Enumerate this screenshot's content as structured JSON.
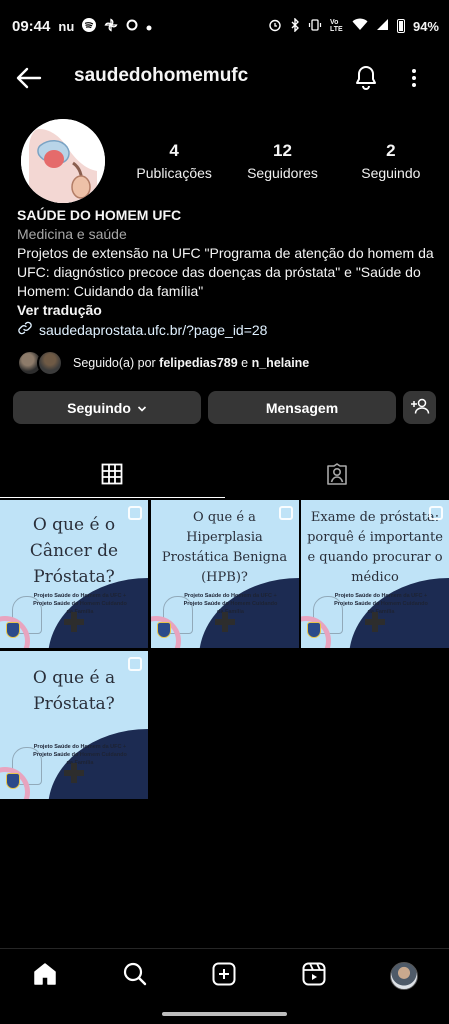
{
  "status_bar": {
    "time": "09:44",
    "left_icons": [
      "nu-icon",
      "spotify-icon",
      "pinwheel-icon",
      "circle-icon",
      "dot-icon"
    ],
    "nu_label": "nu",
    "battery": "94%",
    "network_label": "Vo LTE"
  },
  "header": {
    "username": "saudedohomemufc"
  },
  "profile": {
    "stats": [
      {
        "value": "4",
        "label": "Publicações"
      },
      {
        "value": "12",
        "label": "Seguidores"
      },
      {
        "value": "2",
        "label": "Seguindo"
      }
    ],
    "name": "SAÚDE DO HOMEM UFC",
    "category": "Medicina e saúde",
    "bio": "Projetos de extensão na UFC \"Programa de atenção do homem da UFC: diagnóstico precoce das doenças da próstata\" e \"Saúde do Homem: Cuidando da família\"",
    "translate": "Ver tradução",
    "link": "saudedaprostata.ufc.br/?page_id=28"
  },
  "followed_by": {
    "prefix": "Seguido(a) por ",
    "user1": "felipedias789",
    "joiner": " e ",
    "user2": "n_helaine"
  },
  "actions": {
    "following": "Seguindo",
    "message": "Mensagem"
  },
  "posts": [
    {
      "title": "O que é o Câncer de Próstata?",
      "credits": "Projeto Saúde do Homem da UFC + Projeto Saúde do Homem Cuidando da Família"
    },
    {
      "title": "O que é a Hiperplasia Prostática Benigna (HPB)?",
      "credits": "Projeto Saúde do Homem da UFC + Projeto Saúde do Homem Cuidando da Família"
    },
    {
      "title": "Exame de próstata: porquê é importante e quando procurar o médico",
      "credits": "Projeto Saúde do Homem da UFC + Projeto Saúde do Homem Cuidando da Família"
    },
    {
      "title": "O que é a Próstata?",
      "credits": "Projeto Saúde do Homem da UFC + Projeto Saúde do Homem Cuidando da Família"
    }
  ],
  "colors": {
    "background": "#000000",
    "button": "#363636",
    "post_bg": "#bfe3f7",
    "post_accent": "#1c2b52"
  }
}
